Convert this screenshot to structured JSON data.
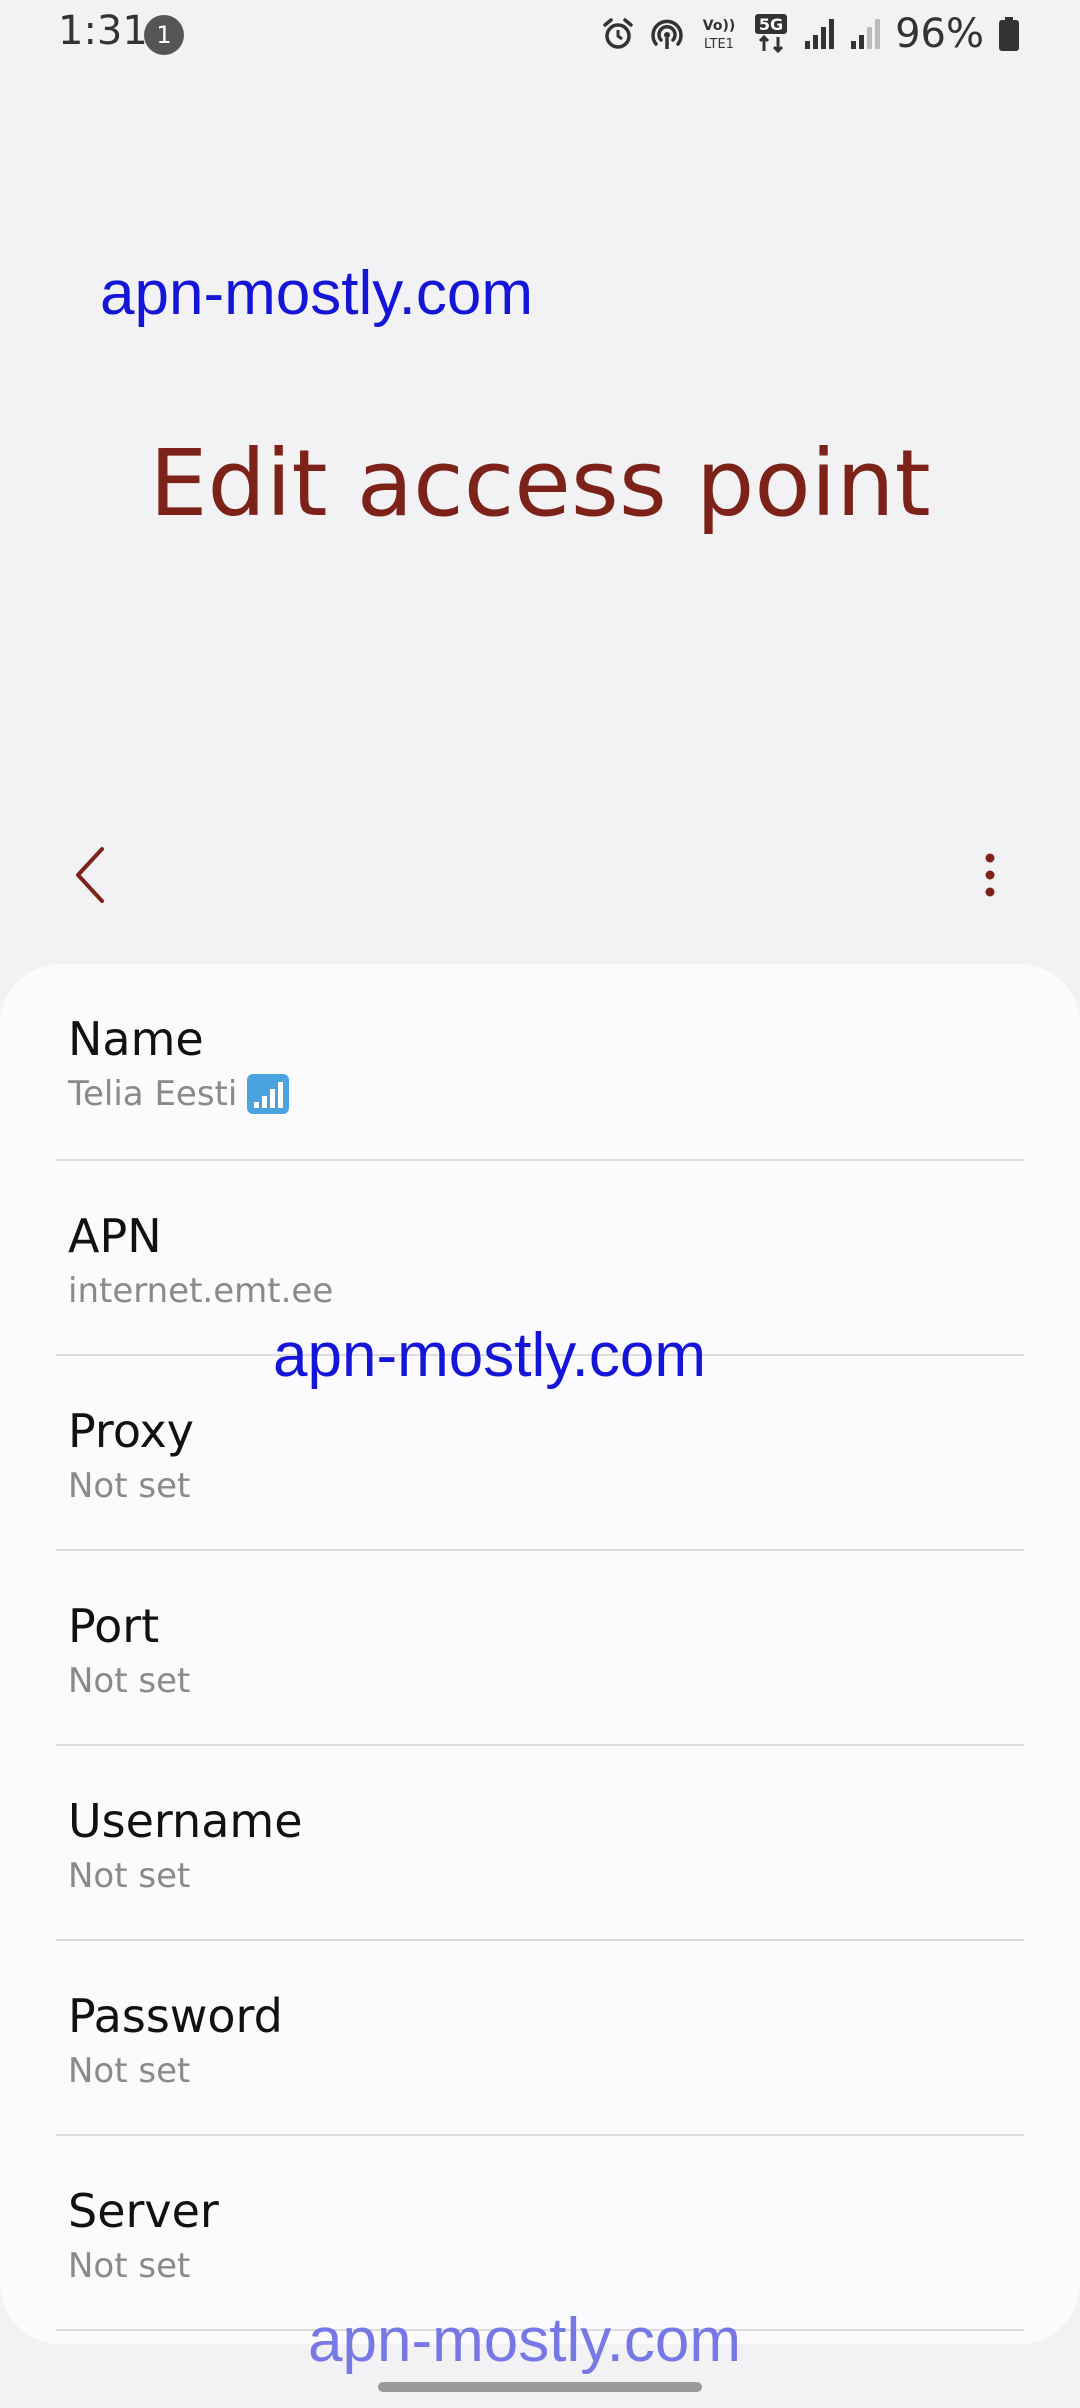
{
  "status_bar": {
    "time": "1:31",
    "notification_count": "1",
    "battery_percent": "96%",
    "icons": [
      "alarm-icon",
      "hotspot-icon",
      "volte-icon",
      "5g-icon",
      "signal-icon",
      "signal-weak-icon",
      "battery-icon"
    ]
  },
  "watermarks": {
    "top": "apn-mostly.com",
    "middle": "apn-mostly.com",
    "bottom": "apn-mostly.com"
  },
  "header": {
    "title": "Edit access point"
  },
  "colors": {
    "title": "#7d2219",
    "watermark": "#1515d8",
    "background": "#f2f2f4",
    "card": "#fbfbfd"
  },
  "settings": [
    {
      "label": "Name",
      "value": "Telia Eesti"
    },
    {
      "label": "APN",
      "value": "internet.emt.ee"
    },
    {
      "label": "Proxy",
      "value": "Not set"
    },
    {
      "label": "Port",
      "value": "Not set"
    },
    {
      "label": "Username",
      "value": "Not set"
    },
    {
      "label": "Password",
      "value": "Not set"
    },
    {
      "label": "Server",
      "value": "Not set"
    }
  ]
}
